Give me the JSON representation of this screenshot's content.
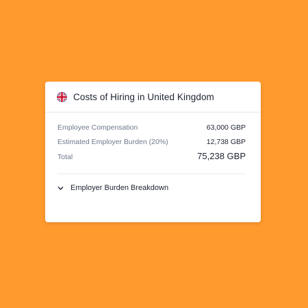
{
  "card": {
    "title": "Costs of Hiring in United Kingdom",
    "flag_icon": "uk-flag-icon",
    "rows": [
      {
        "label": "Employee Compensation",
        "value": "63,000 GBP"
      },
      {
        "label": "Estimated Employer Burden (20%)",
        "value": "12,738 GBP"
      },
      {
        "label": "Total",
        "value": "75,238 GBP"
      }
    ],
    "breakdown": {
      "label": "Employer Burden Breakdown",
      "icon": "chevron-down-icon"
    }
  },
  "colors": {
    "background": "#FF9A2E",
    "card": "#FFFFFF",
    "text_primary": "#1C2230",
    "text_secondary": "#6E778C"
  }
}
